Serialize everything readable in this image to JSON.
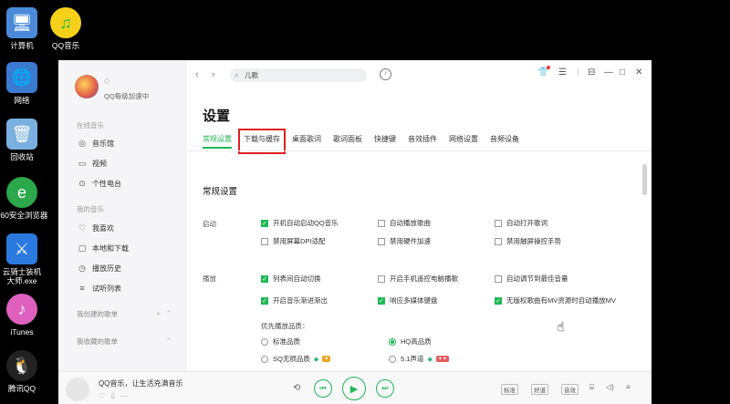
{
  "desktop": {
    "icons": [
      {
        "label": "计算机",
        "icon": "computer-icon",
        "color": "#4a8ad8"
      },
      {
        "label": "QQ音乐",
        "icon": "qq-music-icon",
        "color": "#f7d019"
      },
      {
        "label": "网络",
        "icon": "network-icon",
        "color": "#3a7ad0"
      },
      {
        "label": "回收站",
        "icon": "recycle-bin-icon",
        "color": "#7ab0e0"
      },
      {
        "label": "360安全浏览器",
        "icon": "360-browser-icon",
        "color": "#2aa84a"
      },
      {
        "label": "云骑士装机大师.exe",
        "icon": "yunqishi-icon",
        "color": "#2a7ae0"
      },
      {
        "label": "iTunes",
        "icon": "itunes-icon",
        "color": "#e060c0"
      },
      {
        "label": "腾讯QQ",
        "icon": "tencent-qq-icon",
        "color": "#111111"
      }
    ]
  },
  "sidebar": {
    "vip_text": "QQ每级加速中",
    "sections": [
      {
        "title": "在线音乐",
        "items": [
          {
            "label": "音乐馆",
            "icon": "music-hall-icon"
          },
          {
            "label": "视频",
            "icon": "video-icon"
          },
          {
            "label": "个性电台",
            "icon": "radio-icon"
          }
        ]
      },
      {
        "title": "我的音乐",
        "items": [
          {
            "label": "我喜欢",
            "icon": "heart-icon"
          },
          {
            "label": "本地和下载",
            "icon": "local-download-icon"
          },
          {
            "label": "播放历史",
            "icon": "history-icon"
          },
          {
            "label": "试听列表",
            "icon": "trial-list-icon"
          }
        ]
      }
    ],
    "created_playlists": "我创建的歌单",
    "collected_playlists": "我收藏的歌单"
  },
  "topbar": {
    "search_value": "儿歌"
  },
  "settings": {
    "title": "设置",
    "tabs": [
      "常规设置",
      "下载与缓存",
      "桌面歌词",
      "歌词面板",
      "快捷键",
      "音效插件",
      "网络设置",
      "音频设备"
    ],
    "active_tab_index": 0,
    "highlighted_tab_index": 1,
    "section_title": "常规设置",
    "startup": {
      "label": "启动",
      "options": [
        {
          "label": "开机自动启动QQ音乐",
          "checked": true
        },
        {
          "label": "自动播放歌曲",
          "checked": false
        },
        {
          "label": "自动打开歌词",
          "checked": false
        },
        {
          "label": "禁用屏幕DPI适配",
          "checked": false
        },
        {
          "label": "禁用硬件加速",
          "checked": false
        },
        {
          "label": "禁用触屏操控手势",
          "checked": false
        }
      ]
    },
    "playback": {
      "label": "播放",
      "options": [
        {
          "label": "列表间自动切换",
          "checked": true
        },
        {
          "label": "开启手机遥控电脑播歌",
          "checked": false
        },
        {
          "label": "自动调节到最佳音量",
          "checked": false
        },
        {
          "label": "开启音乐渐进渐出",
          "checked": true
        },
        {
          "label": "响应多媒体键盘",
          "checked": true
        },
        {
          "label": "无版权歌曲有MV资源时自动播放MV",
          "checked": true
        }
      ]
    },
    "quality": {
      "label": "优先播放品质：",
      "options": [
        {
          "label": "标准品质",
          "selected": false
        },
        {
          "label": "HQ高品质",
          "selected": true
        },
        {
          "label": "SQ无损品质",
          "selected": false
        },
        {
          "label": "5.1声道",
          "selected": false
        }
      ]
    }
  },
  "player": {
    "song_text": "QQ音乐，让生活充满音乐",
    "mode_chip": "标准",
    "quality_chip": "好道",
    "effect_chip": "音效"
  },
  "colors": {
    "accent": "#1db954",
    "highlight_box": "#e02020"
  }
}
